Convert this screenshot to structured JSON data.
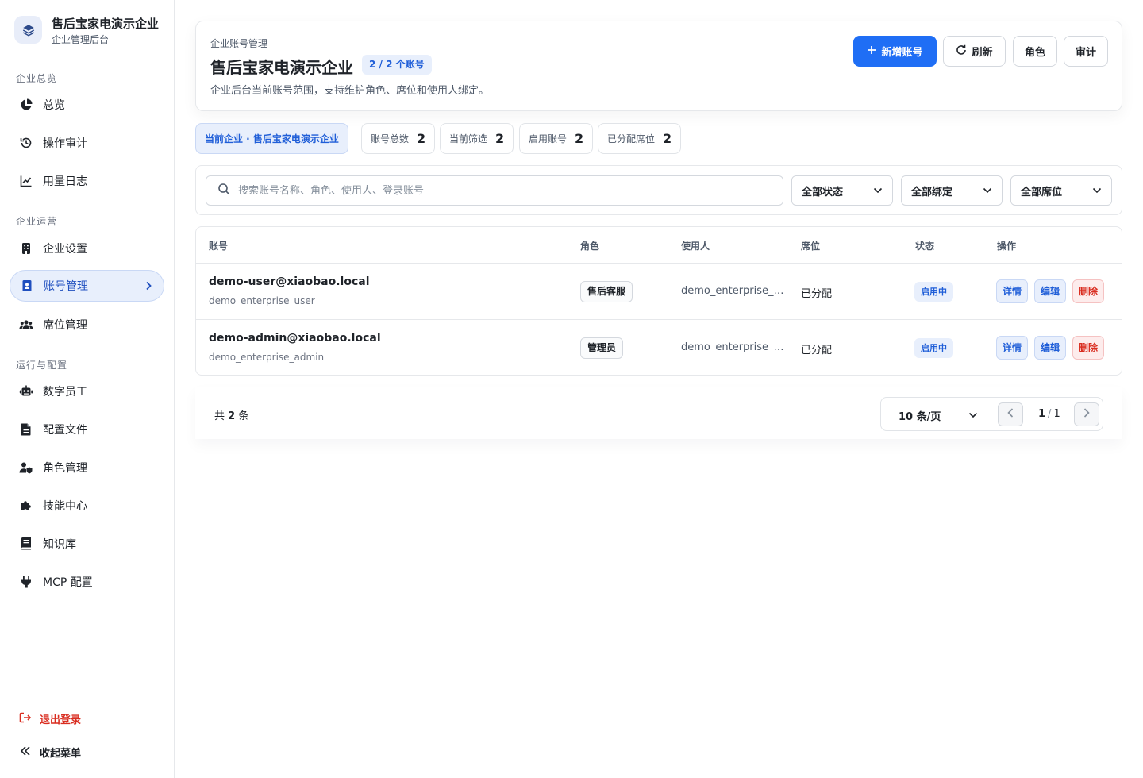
{
  "sidebar": {
    "brand_title": "售后宝家电演示企业",
    "brand_subtitle": "企业管理后台",
    "sections": [
      {
        "label": "企业总览",
        "items": [
          {
            "label": "总览",
            "icon": "pie-chart-icon"
          },
          {
            "label": "操作审计",
            "icon": "history-icon"
          },
          {
            "label": "用量日志",
            "icon": "line-chart-icon"
          }
        ]
      },
      {
        "label": "企业运营",
        "items": [
          {
            "label": "企业设置",
            "icon": "building-icon"
          },
          {
            "label": "账号管理",
            "icon": "id-card-icon",
            "active": true
          },
          {
            "label": "席位管理",
            "icon": "users-icon"
          }
        ]
      },
      {
        "label": "运行与配置",
        "items": [
          {
            "label": "数字员工",
            "icon": "robot-icon"
          },
          {
            "label": "配置文件",
            "icon": "file-icon"
          },
          {
            "label": "角色管理",
            "icon": "user-shield-icon"
          },
          {
            "label": "技能中心",
            "icon": "puzzle-icon"
          },
          {
            "label": "知识库",
            "icon": "book-icon"
          },
          {
            "label": "MCP 配置",
            "icon": "plug-icon"
          }
        ]
      }
    ],
    "logout_label": "退出登录",
    "collapse_label": "收起菜单"
  },
  "header": {
    "eyebrow": "企业账号管理",
    "title": "售后宝家电演示企业",
    "count_badge": "2 / 2 个账号",
    "description": "企业后台当前账号范围，支持维护角色、席位和使用人绑定。",
    "buttons": {
      "add": "新增账号",
      "refresh": "刷新",
      "roles": "角色",
      "audit": "审计"
    }
  },
  "stats": {
    "current_enterprise": "当前企业 · 售后宝家电演示企业",
    "items": [
      {
        "label": "账号总数",
        "value": "2"
      },
      {
        "label": "当前筛选",
        "value": "2"
      },
      {
        "label": "启用账号",
        "value": "2"
      },
      {
        "label": "已分配席位",
        "value": "2"
      }
    ]
  },
  "filters": {
    "search_placeholder": "搜索账号名称、角色、使用人、登录账号",
    "status": "全部状态",
    "binding": "全部绑定",
    "seat": "全部席位"
  },
  "table": {
    "columns": [
      "账号",
      "角色",
      "使用人",
      "席位",
      "状态",
      "操作"
    ],
    "rows": [
      {
        "account": "demo-user@xiaobao.local",
        "login": "demo_enterprise_user",
        "role": "售后客服",
        "user": "demo_enterprise_user",
        "seat": "已分配",
        "status": "启用中"
      },
      {
        "account": "demo-admin@xiaobao.local",
        "login": "demo_enterprise_admin",
        "role": "管理员",
        "user": "demo_enterprise_admin",
        "seat": "已分配",
        "status": "启用中"
      }
    ],
    "actions": {
      "detail": "详情",
      "edit": "编辑",
      "delete": "删除"
    }
  },
  "pagination": {
    "total_prefix": "共",
    "total": "2",
    "total_suffix": "条",
    "page_size": "10 条/页",
    "current_page": "1",
    "total_pages": "1"
  },
  "colors": {
    "primary": "#1f6ef5",
    "active_bg": "#e8effc",
    "danger": "#d92d20"
  }
}
